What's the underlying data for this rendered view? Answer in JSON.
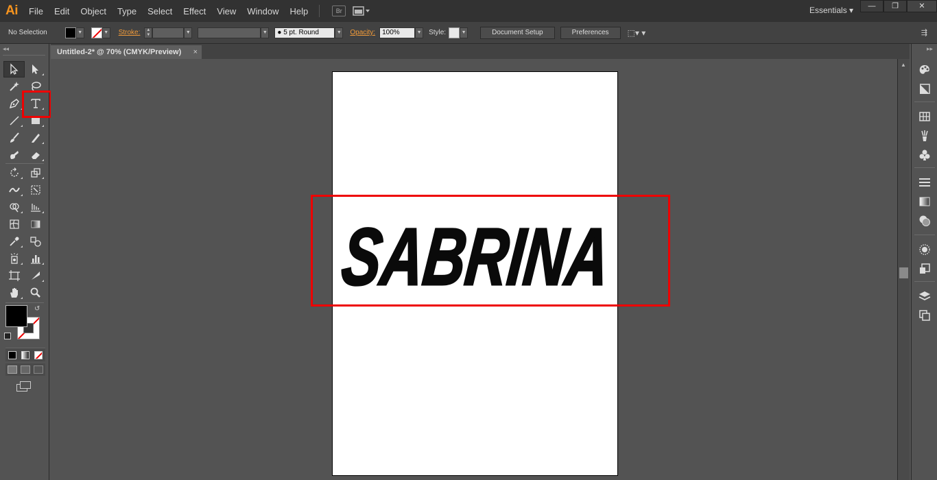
{
  "app": {
    "logo": "Ai"
  },
  "menu": [
    "File",
    "Edit",
    "Object",
    "Type",
    "Select",
    "Effect",
    "View",
    "Window",
    "Help"
  ],
  "bridge_label": "Br",
  "workspace": "Essentials ▾",
  "window_controls": {
    "minimize": "—",
    "restore": "❐",
    "close": "✕"
  },
  "control_bar": {
    "selection_status": "No Selection",
    "stroke_label": "Stroke:",
    "brush_profile": "● 5 pt. Round",
    "opacity_label": "Opacity:",
    "opacity_value": "100%",
    "style_label": "Style:",
    "document_setup": "Document Setup",
    "preferences": "Preferences"
  },
  "document_tab": {
    "title": "Untitled-2* @ 70% (CMYK/Preview)",
    "close": "×"
  },
  "artboard": {
    "text": "SABRINA"
  },
  "colors": {
    "accent": "#f7941e",
    "highlight": "#e00000"
  }
}
